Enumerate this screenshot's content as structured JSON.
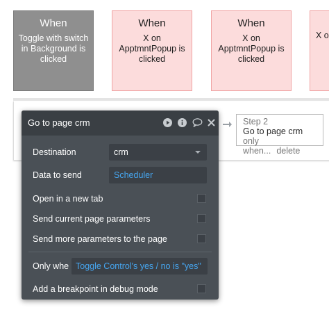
{
  "events": [
    {
      "when": "When",
      "desc": "Toggle with switch in Background is clicked"
    },
    {
      "when": "When",
      "desc": "X on ApptmntPopup is clicked"
    },
    {
      "when": "When",
      "desc": "X on ApptmntPopup is clicked"
    },
    {
      "when": "",
      "desc": "X o"
    }
  ],
  "step2": {
    "number": "Step 2",
    "action": "Go to page crm",
    "condition": "only when...",
    "delete_label": "delete"
  },
  "editor": {
    "title": "Go to page crm",
    "icons": [
      "play-icon",
      "info-icon",
      "comment-icon",
      "close-icon"
    ],
    "destination_label": "Destination",
    "destination_value": "crm",
    "data_label": "Data to send",
    "data_value": "Scheduler",
    "new_tab_label": "Open in a new tab",
    "send_current_label": "Send current page parameters",
    "send_more_label": "Send more parameters to the page",
    "only_when_label": "Only whe",
    "only_when_value": "Toggle Control's yes / no is \"yes\"",
    "breakpoint_label": "Add a breakpoint in debug mode"
  },
  "colors": {
    "selected_card": "#8f8f8f",
    "pink_card": "#fcdcdc",
    "pink_border": "#f0a3a3",
    "editor_bg": "#4a5056",
    "editor_header": "#3a3f44",
    "expression_blue": "#46a6f0"
  }
}
